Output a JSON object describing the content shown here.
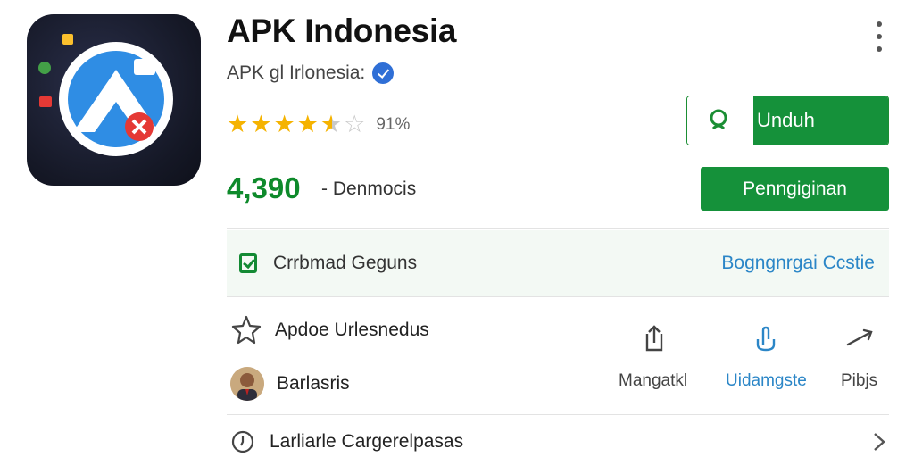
{
  "app": {
    "title": "APK Indonesia",
    "developer": "APK gl Irlonesia:",
    "rating_percent": "91%",
    "rating_stars": 4.5,
    "download_count": "4,390",
    "download_suffix": "- Denmocis"
  },
  "buttons": {
    "unduh_label": "Unduh",
    "primary_label": "Penngiginan"
  },
  "banner": {
    "text": "Crrbmad Geguns",
    "link": "Bogngnrgai Ccstie"
  },
  "details": {
    "feature_text": "Apdoe Urlesnedus",
    "author_text": "Barlasris"
  },
  "actions": [
    {
      "label": "Mangatkl",
      "icon": "share-icon"
    },
    {
      "label": "Uidamgste",
      "icon": "touch-icon"
    },
    {
      "label": "Pibjs",
      "icon": "forward-arrow-icon"
    }
  ],
  "bottom": {
    "text": "Larliarle Cargerelpasas"
  },
  "colors": {
    "brand_green": "#15913a",
    "link_blue": "#2b86c7",
    "star": "#f5b301"
  }
}
